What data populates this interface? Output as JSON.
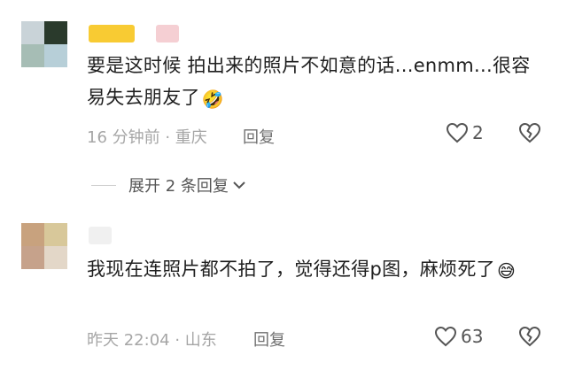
{
  "comments": [
    {
      "text": "要是这时候 拍出来的照片不如意的话...enmm...很容易失去朋友了",
      "emoji": "🤣",
      "time_location": "16 分钟前 · 重庆",
      "reply_label": "回复",
      "like_count": "2",
      "avatar_colors": [
        "#c9d3d8",
        "#2a3a2c",
        "#a6bdb5",
        "#b7cfd8"
      ],
      "name_colors": [
        "#f5c326",
        "#f3c9cf"
      ]
    },
    {
      "text": "我现在连照片都不拍了，觉得还得p图，麻烦死了",
      "emoji": "😅",
      "time_location": "昨天 22:04 · 山东",
      "reply_label": "回复",
      "like_count": "63",
      "avatar_colors": [
        "#c8a27e",
        "#d8c89a",
        "#c6a28b",
        "#e3d7c8"
      ],
      "name_colors": [
        "#eeeeee"
      ]
    }
  ],
  "expand_replies": "展开 2 条回复"
}
